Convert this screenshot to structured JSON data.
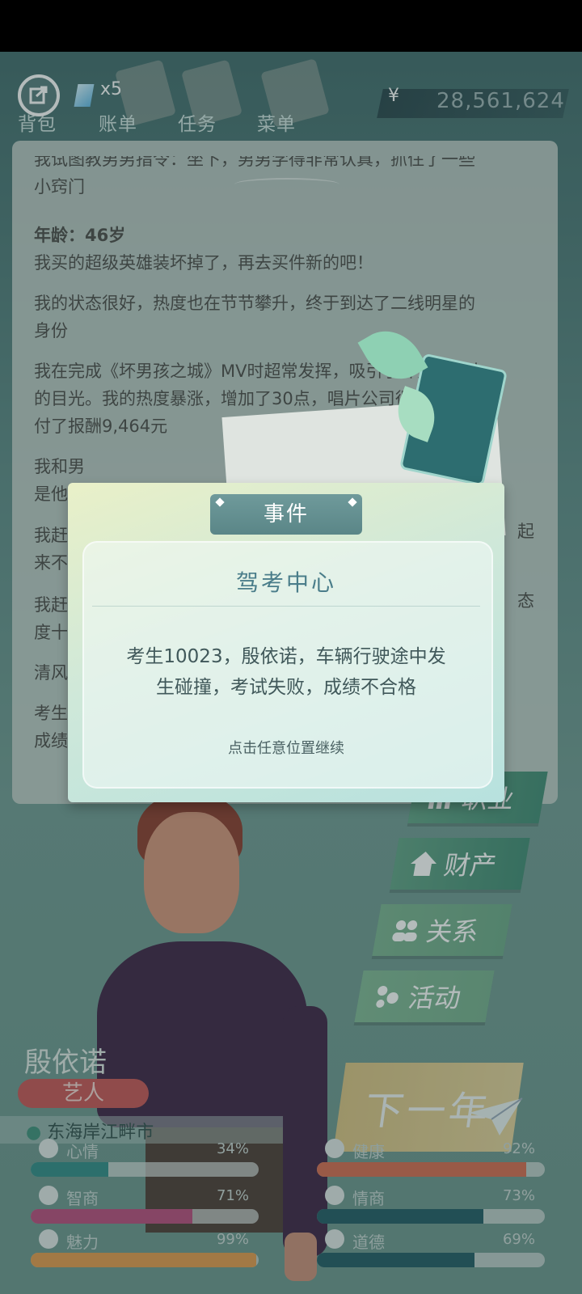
{
  "topbar": {
    "gem_count": "x5",
    "tabs": [
      "背包",
      "账单",
      "任务",
      "菜单"
    ],
    "currency_symbol": "¥",
    "money": "28,561,624"
  },
  "log": {
    "lines": [
      {
        "text": "我试图教男男指令：坐下，男男学得非常认真，抓住了一些",
        "bold": false
      },
      {
        "text": "小窍门",
        "bold": false
      },
      {
        "text": "年龄：46岁",
        "bold": true
      },
      {
        "text": "我买的超级英雄装坏掉了，再去买件新的吧！",
        "bold": false
      },
      {
        "text": "我的状态很好，热度也在节节攀升，终于到达了二线明星的",
        "bold": false
      },
      {
        "text": "身份",
        "bold": false
      },
      {
        "text": "我在完成《坏男孩之城》MV时超常发挥，吸引了许多年轻人",
        "bold": false
      },
      {
        "text": "的目光。我的热度暴涨，增加了30点，唱片公司很满意，支",
        "bold": false
      },
      {
        "text": "付了报酬9,464元",
        "bold": false
      },
      {
        "text": "我和男",
        "bold": false
      },
      {
        "text": "是他",
        "bold": false
      },
      {
        "text": "我赶",
        "bold": false
      },
      {
        "text": "来不",
        "bold": false
      },
      {
        "text": "我赶",
        "bold": false
      },
      {
        "text": "度十",
        "bold": false
      },
      {
        "text": "清风",
        "bold": false
      },
      {
        "text": "考生",
        "bold": false
      },
      {
        "text": "成绩",
        "bold": false
      }
    ],
    "right_fragments": [
      "起",
      "态"
    ]
  },
  "modal": {
    "header": "事件",
    "title": "驾考中心",
    "body_line1": "考生10023，殷依诺，车辆行驶途中发",
    "body_line2": "生碰撞，考试失败，成绩不合格",
    "hint": "点击任意位置继续"
  },
  "side_buttons": {
    "career": "职业",
    "assets": "财产",
    "relations": "关系",
    "activities": "活动",
    "next_year": "下一年"
  },
  "character": {
    "name": "殷依诺",
    "job": "艺人",
    "location": "东海岸江畔市"
  },
  "stats": [
    {
      "label": "心情",
      "value": "34%",
      "level": 0.34,
      "color": "#2f8a86",
      "icon": "smile-icon"
    },
    {
      "label": "健康",
      "value": "92%",
      "level": 0.92,
      "color": "#d66b4e",
      "icon": "heart-icon"
    },
    {
      "label": "智商",
      "value": "71%",
      "level": 0.71,
      "color": "#b84b7c",
      "icon": "bulb-icon"
    },
    {
      "label": "情商",
      "value": "73%",
      "level": 0.73,
      "color": "#1f5a63",
      "icon": "apple-icon"
    },
    {
      "label": "魅力",
      "value": "99%",
      "level": 0.99,
      "color": "#e39a4a",
      "icon": "sparkle-icon"
    },
    {
      "label": "道德",
      "value": "69%",
      "level": 0.69,
      "color": "#1f5a63",
      "icon": "scale-icon"
    }
  ]
}
